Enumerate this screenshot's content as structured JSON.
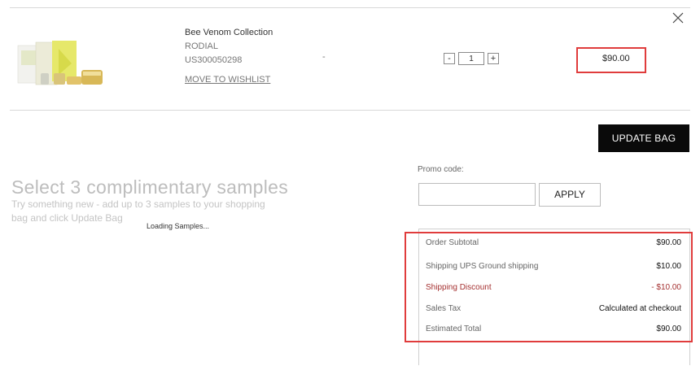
{
  "item": {
    "name": "Bee Venom Collection",
    "brand": "RODIAL",
    "sku": "US300050298",
    "wishlist_label": "MOVE TO WISHLIST",
    "dash": "-",
    "qty_minus": "-",
    "qty_value": "1",
    "qty_plus": "+",
    "price": "$90.00",
    "close_icon": "close-icon",
    "colors": {
      "highlight": "#e03c3c"
    }
  },
  "actions": {
    "update_bag_label": "UPDATE BAG"
  },
  "samples": {
    "title": "Select 3 complimentary samples",
    "description": "Try something new - add up to 3 samples to your shopping bag and click Update Bag",
    "loading": "Loading Samples..."
  },
  "promo": {
    "label": "Promo code:",
    "value": "",
    "apply_label": "APPLY"
  },
  "summary": {
    "rows": [
      {
        "label": "Order Subtotal",
        "value": "$90.00"
      },
      {
        "label": "Shipping UPS Ground shipping",
        "value": "$10.00"
      },
      {
        "label": "Shipping Discount",
        "value": "- $10.00"
      },
      {
        "label": "Sales Tax",
        "value": "Calculated at checkout"
      },
      {
        "label": "Estimated Total",
        "value": "$90.00"
      }
    ],
    "colors": {
      "discount": "#a53131",
      "highlight": "#e03c3c"
    }
  }
}
